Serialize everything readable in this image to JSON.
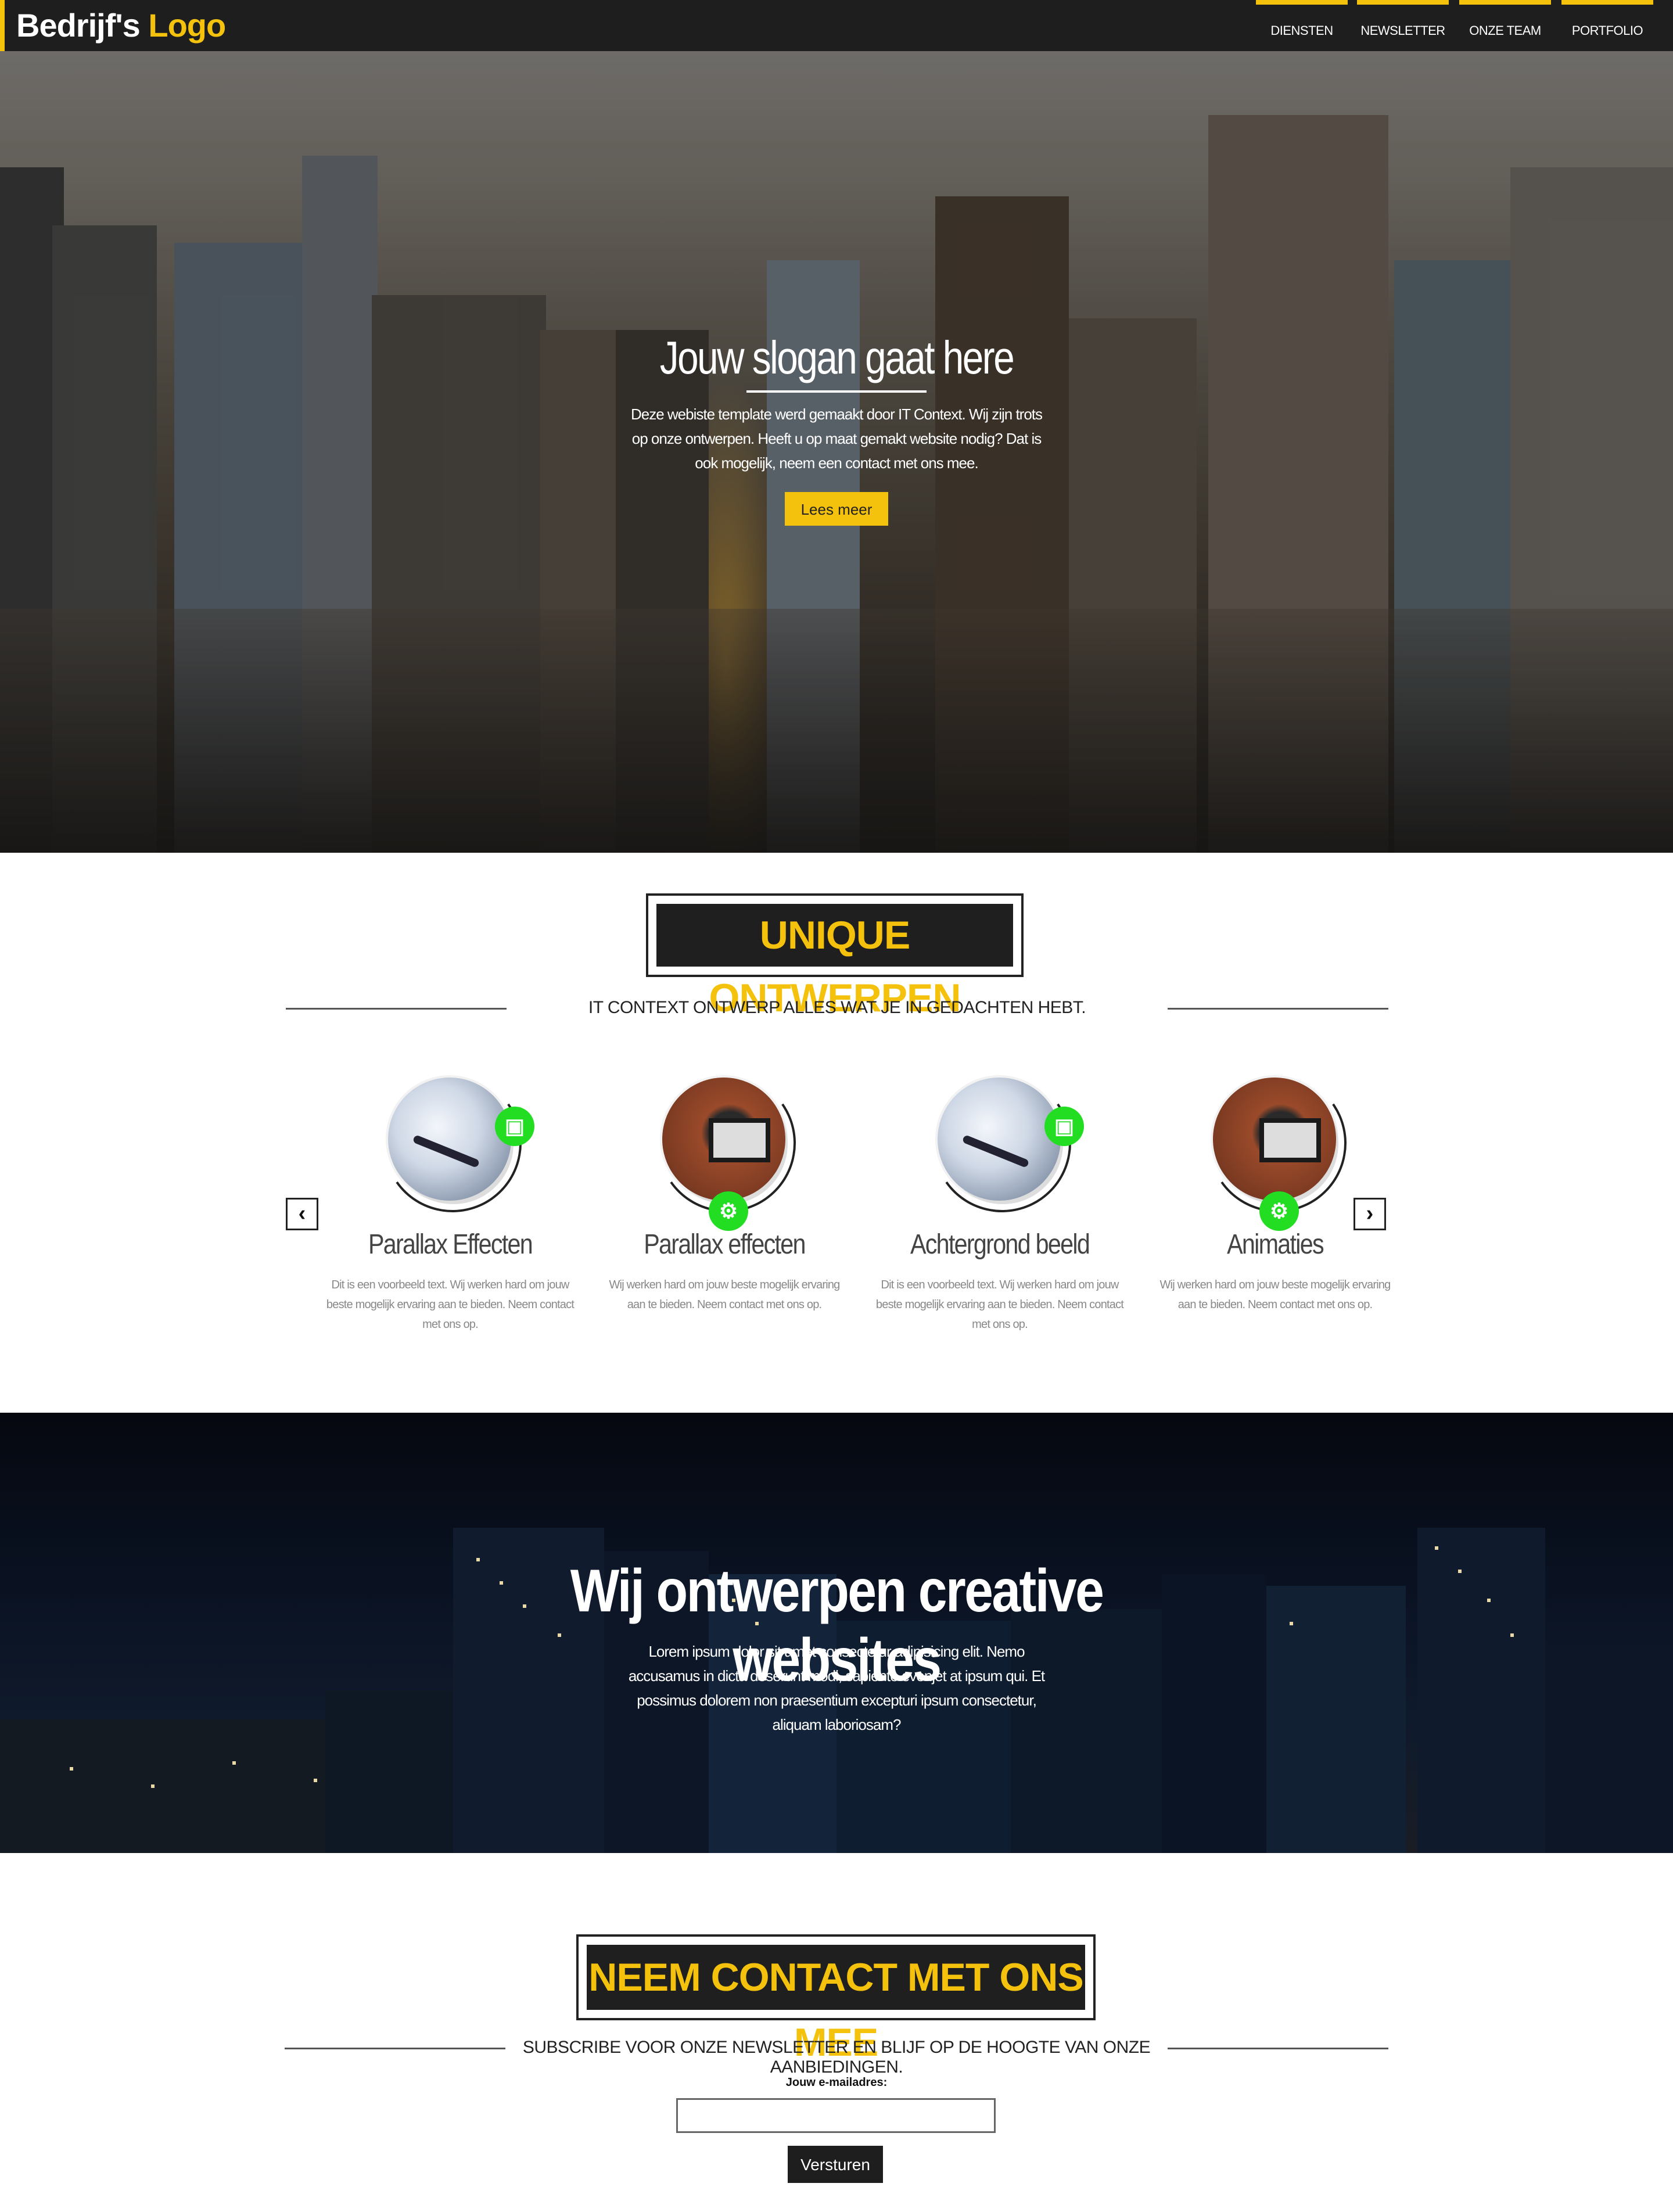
{
  "brand": {
    "logo_part1": "Bedrijf's",
    "logo_part2": "Logo",
    "accent": "#f4c20d",
    "dark": "#1e1e1e"
  },
  "nav": {
    "items": [
      "DIENSTEN",
      "NEWSLETTER",
      "ONZE TEAM",
      "PORTFOLIO"
    ]
  },
  "hero": {
    "title": "Jouw slogan gaat here",
    "text": "Deze webiste template werd gemaakt door IT Context. Wij zijn trots op onze ontwerpen. Heeft u op maat gemakt website nodig? Dat is ook mogelijk, neem een contact met ons mee.",
    "button": "Lees meer"
  },
  "features": {
    "title": "UNIQUE ONTWERPEN",
    "subtitle": "IT CONTEXT ONTWERP ALLES WAT JE IN GEDACHTEN HEBT.",
    "prev": "‹",
    "next": "›",
    "cards": [
      {
        "title": "Parallax Effecten",
        "text": "Dit is een voorbeeld text. Wij werken hard om jouw beste mogelijk ervaring aan te bieden. Neem contact met ons op.",
        "icon": "image-icon",
        "image": "desk"
      },
      {
        "title": "Parallax effecten",
        "text": "Wij werken hard om jouw beste mogelijk ervaring aan te bieden. Neem contact met ons op.",
        "icon": "gears-icon",
        "image": "laptop"
      },
      {
        "title": "Achtergrond beeld",
        "text": "Dit is een voorbeeld text. Wij werken hard om jouw beste mogelijk ervaring aan te bieden. Neem contact met ons op.",
        "icon": "image-icon",
        "image": "desk"
      },
      {
        "title": "Animaties",
        "text": "Wij werken hard om jouw beste mogelijk ervaring aan te bieden. Neem contact met ons op.",
        "icon": "gears-icon",
        "image": "laptop"
      }
    ]
  },
  "banner": {
    "title": "Wij ontwerpen creative websites",
    "text": "Lorem ipsum dolor sit amet consectetur adipisicing elit. Nemo accusamus in dicta deserunt modi, sapiente evenjet at ipsum qui. Et possimus dolorem non praesentium excepturi ipsum consectetur, aliquam laboriosam?"
  },
  "contact": {
    "title": "NEEM CONTACT MET ONS MEE",
    "subtitle": "SUBSCRIBE VOOR ONZE NEWSLETTER EN BLIJF OP DE HOOGTE VAN ONZE AANBIEDINGEN.",
    "email_label": "Jouw e-mailadres:",
    "email_value": "",
    "button": "Versturen"
  }
}
